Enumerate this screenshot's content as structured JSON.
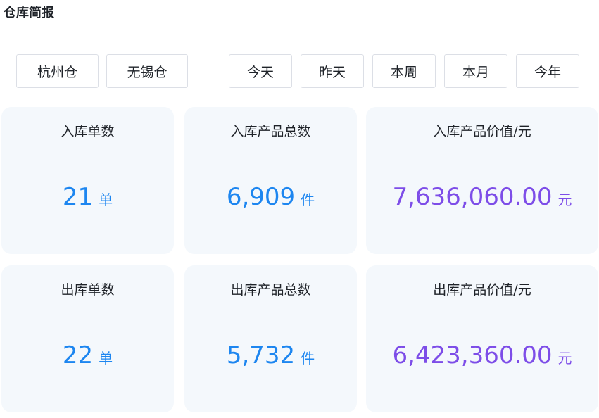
{
  "header": {
    "title": "仓库简报"
  },
  "warehouses": [
    {
      "label": "杭州仓"
    },
    {
      "label": "无锡仓"
    }
  ],
  "periods": [
    {
      "label": "今天"
    },
    {
      "label": "昨天"
    },
    {
      "label": "本周"
    },
    {
      "label": "本月"
    },
    {
      "label": "今年"
    }
  ],
  "stats": {
    "inbound_orders": {
      "label": "入库单数",
      "value": "21",
      "unit": "单"
    },
    "inbound_qty": {
      "label": "入库产品总数",
      "value": "6,909",
      "unit": "件"
    },
    "inbound_value": {
      "label": "入库产品价值/元",
      "value": "7,636,060.00",
      "unit": "元"
    },
    "outbound_orders": {
      "label": "出库单数",
      "value": "22",
      "unit": "单"
    },
    "outbound_qty": {
      "label": "出库产品总数",
      "value": "5,732",
      "unit": "件"
    },
    "outbound_value": {
      "label": "出库产品价值/元",
      "value": "6,423,360.00",
      "unit": "元"
    }
  },
  "colors": {
    "count_color": "#1d86f0",
    "value_color": "#7d4de8",
    "card_bg": "#f4f8fc"
  }
}
